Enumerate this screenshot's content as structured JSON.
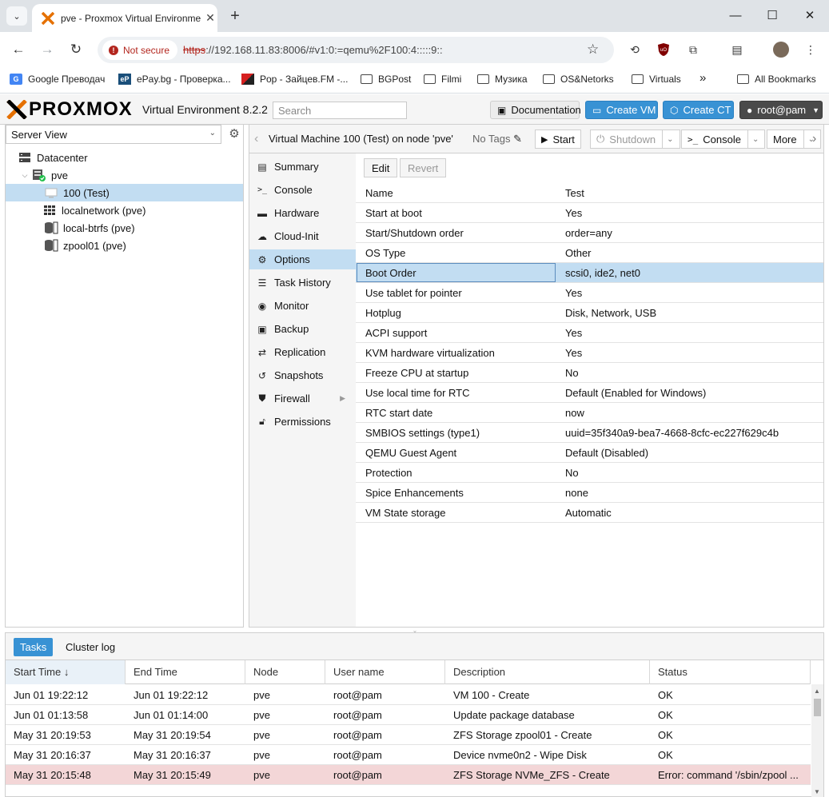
{
  "browser": {
    "tab_title": "pve - Proxmox Virtual Environment",
    "security_label": "Not secure",
    "url_scheme": "https",
    "url_rest": "://192.168.11.83:8006/#v1:0:=qemu%2F100:4:::::9::",
    "bookmarks": [
      {
        "label": "Google Преводач"
      },
      {
        "label": "ePay.bg - Проверка..."
      },
      {
        "label": "Pop - Зайцев.FM -..."
      },
      {
        "label": "BGPost"
      },
      {
        "label": "Filmi"
      },
      {
        "label": "Музика"
      },
      {
        "label": "OS&Netorks"
      },
      {
        "label": "Virtuals"
      }
    ],
    "bookmarks_overflow": "»",
    "all_bookmarks": "All Bookmarks"
  },
  "header": {
    "logo": "PROXMOX",
    "version": "Virtual Environment 8.2.2",
    "search_placeholder": "Search",
    "documentation": "Documentation",
    "create_vm": "Create VM",
    "create_ct": "Create CT",
    "user": "root@pam"
  },
  "tree": {
    "view": "Server View",
    "items": [
      {
        "label": "Datacenter"
      },
      {
        "label": "pve"
      },
      {
        "label": "100 (Test)"
      },
      {
        "label": "localnetwork (pve)"
      },
      {
        "label": "local-btrfs (pve)"
      },
      {
        "label": "zpool01 (pve)"
      }
    ]
  },
  "toolbar": {
    "title": "Virtual Machine 100 (Test) on node 'pve'",
    "no_tags": "No Tags",
    "start": "Start",
    "shutdown": "Shutdown",
    "console": "Console",
    "more": "More"
  },
  "subnav": [
    {
      "label": "Summary",
      "icon": "clipboard-icon"
    },
    {
      "label": "Console",
      "icon": "terminal-icon"
    },
    {
      "label": "Hardware",
      "icon": "monitor-icon"
    },
    {
      "label": "Cloud-Init",
      "icon": "cloud-icon"
    },
    {
      "label": "Options",
      "icon": "gear-icon"
    },
    {
      "label": "Task History",
      "icon": "list-icon"
    },
    {
      "label": "Monitor",
      "icon": "eye-icon"
    },
    {
      "label": "Backup",
      "icon": "floppy-icon"
    },
    {
      "label": "Replication",
      "icon": "retweet-icon"
    },
    {
      "label": "Snapshots",
      "icon": "history-icon"
    },
    {
      "label": "Firewall",
      "icon": "shield-icon"
    },
    {
      "label": "Permissions",
      "icon": "unlock-icon"
    }
  ],
  "options": {
    "edit": "Edit",
    "revert": "Revert",
    "rows": [
      {
        "key": "Name",
        "value": "Test"
      },
      {
        "key": "Start at boot",
        "value": "Yes"
      },
      {
        "key": "Start/Shutdown order",
        "value": "order=any"
      },
      {
        "key": "OS Type",
        "value": "Other"
      },
      {
        "key": "Boot Order",
        "value": "scsi0, ide2, net0"
      },
      {
        "key": "Use tablet for pointer",
        "value": "Yes"
      },
      {
        "key": "Hotplug",
        "value": "Disk, Network, USB"
      },
      {
        "key": "ACPI support",
        "value": "Yes"
      },
      {
        "key": "KVM hardware virtualization",
        "value": "Yes"
      },
      {
        "key": "Freeze CPU at startup",
        "value": "No"
      },
      {
        "key": "Use local time for RTC",
        "value": "Default (Enabled for Windows)"
      },
      {
        "key": "RTC start date",
        "value": "now"
      },
      {
        "key": "SMBIOS settings (type1)",
        "value": "uuid=35f340a9-bea7-4668-8cfc-ec227f629c4b"
      },
      {
        "key": "QEMU Guest Agent",
        "value": "Default (Disabled)"
      },
      {
        "key": "Protection",
        "value": "No"
      },
      {
        "key": "Spice Enhancements",
        "value": "none"
      },
      {
        "key": "VM State storage",
        "value": "Automatic"
      }
    ]
  },
  "tasks": {
    "tab_tasks": "Tasks",
    "tab_cluster_log": "Cluster log",
    "columns": [
      "Start Time ↓",
      "End Time",
      "Node",
      "User name",
      "Description",
      "Status"
    ],
    "rows": [
      [
        "Jun 01 19:22:12",
        "Jun 01 19:22:12",
        "pve",
        "root@pam",
        "VM 100 - Create",
        "OK"
      ],
      [
        "Jun 01 01:13:58",
        "Jun 01 01:14:00",
        "pve",
        "root@pam",
        "Update package database",
        "OK"
      ],
      [
        "May 31 20:19:53",
        "May 31 20:19:54",
        "pve",
        "root@pam",
        "ZFS Storage zpool01 - Create",
        "OK"
      ],
      [
        "May 31 20:16:37",
        "May 31 20:16:37",
        "pve",
        "root@pam",
        "Device nvme0n2 - Wipe Disk",
        "OK"
      ],
      [
        "May 31 20:15:48",
        "May 31 20:15:49",
        "pve",
        "root@pam",
        "ZFS Storage NVMe_ZFS - Create",
        "Error: command '/sbin/zpool ..."
      ]
    ]
  }
}
